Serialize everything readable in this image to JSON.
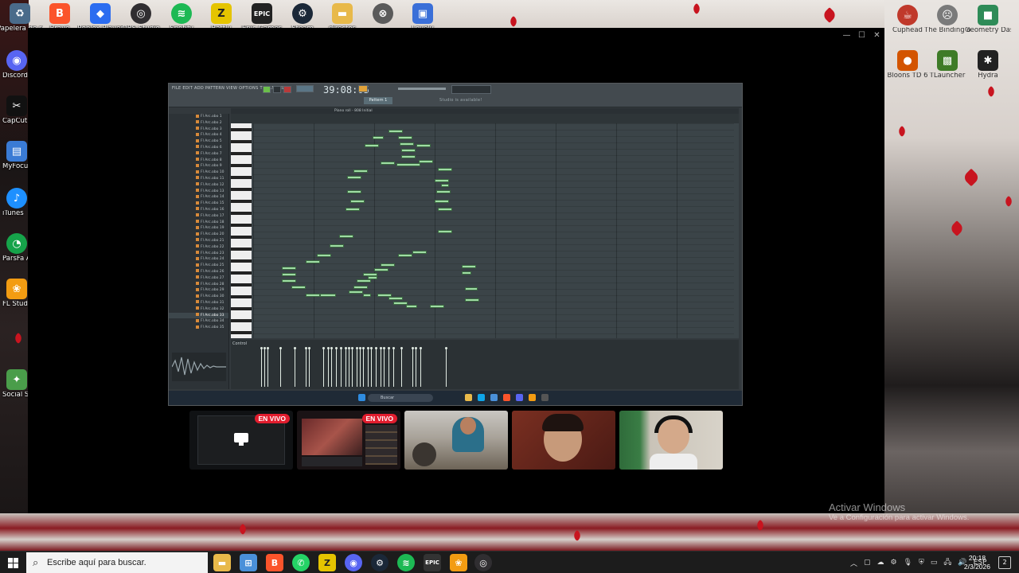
{
  "desktop": {
    "top_icons": [
      {
        "label": "Papelera de reciclaje",
        "icon": "recycle-bin-icon",
        "color": "#4a6b8a"
      },
      {
        "label": "Brave",
        "icon": "brave-icon",
        "color": "#fb542b"
      },
      {
        "label": "Roblox Player",
        "icon": "roblox-icon",
        "color": "#2b6cf0"
      },
      {
        "label": "OBS Studio",
        "icon": "obs-icon",
        "color": "#302e31"
      },
      {
        "label": "Spotify",
        "icon": "spotify-icon",
        "color": "#1db954"
      },
      {
        "label": "Battly",
        "icon": "battly-icon",
        "color": "#e5c400"
      },
      {
        "label": "Epic Games",
        "icon": "epic-games-icon",
        "color": "#222222"
      },
      {
        "label": "Steam",
        "icon": "steam-icon",
        "color": "#1b2838"
      },
      {
        "label": "directos",
        "icon": "folder-icon",
        "color": "#e8b94a"
      },
      {
        "label": "",
        "icon": "app-icon",
        "color": "#5a5a5a"
      },
      {
        "label": "Lovely",
        "icon": "lovely-icon",
        "color": "#3a6fd8"
      }
    ],
    "left_icons": [
      {
        "label": "Discord",
        "icon": "discord-icon",
        "color": "#5865f2"
      },
      {
        "label": "CapCut",
        "icon": "capcut-icon",
        "color": "#111111"
      },
      {
        "label": "MyFocus LockWi...",
        "icon": "lock-icon",
        "color": "#3a7bd5"
      },
      {
        "label": "iTunes",
        "icon": "itunes-icon",
        "color": "#1e90ff"
      },
      {
        "label": "ParsFa Andro...",
        "icon": "android-icon",
        "color": "#16a34a"
      },
      {
        "label": "FL Studio",
        "icon": "fl-studio-icon",
        "color": "#f39c12"
      },
      {
        "label": "Social Stre... Ninja",
        "icon": "ninja-icon",
        "color": "#4a9d4a"
      }
    ],
    "right_icons": [
      {
        "label": "Cuphead",
        "icon": "cuphead-icon",
        "color": "#c0392b"
      },
      {
        "label": "The Binding of Isaac R...",
        "icon": "isaac-icon",
        "color": "#7a7a7a"
      },
      {
        "label": "Geometry Dash",
        "icon": "geometry-dash-icon",
        "color": "#2e8b57"
      },
      {
        "label": "Bloons TD 6",
        "icon": "bloons-icon",
        "color": "#d35400"
      },
      {
        "label": "TLauncher",
        "icon": "minecraft-icon",
        "color": "#3e7b27"
      },
      {
        "label": "Hydra",
        "icon": "hydra-icon",
        "color": "#222222"
      }
    ]
  },
  "window": {
    "controls": {
      "minimize": "—",
      "maximize": "☐",
      "close": "✕"
    }
  },
  "fl": {
    "menu": "FILE EDIT ADD PATTERN VIEW OPTIONS TOOLS HELP",
    "time": "39:08:05",
    "pattern": "Pattern 1",
    "hint": "Studio is available!",
    "plugin_bar": "Piano roll - 808 Initial",
    "control_label": "Control",
    "browser_rows": [
      "Fl Arc.obo 1",
      "Fl Arc.obo 2",
      "Fl Arc.obo 3",
      "Fl Arc.obo 4",
      "Fl Arc.obo 5",
      "Fl Arc.obo 6",
      "Fl Arc.obo 7",
      "Fl Arc.obo 8",
      "Fl Arc.obo 9",
      "Fl Arc.obo 10",
      "Fl Arc.obo 11",
      "Fl Arc.obo 12",
      "Fl Arc.obo 13",
      "Fl Arc.obo 14",
      "Fl Arc.obo 15",
      "Fl Arc.obo 16",
      "Fl Arc.obo 17",
      "Fl Arc.obo 18",
      "Fl Arc.obo 19",
      "Fl Arc.obo 20",
      "Fl Arc.obo 21",
      "Fl Arc.obo 22",
      "Fl Arc.obo 23",
      "Fl Arc.obo 24",
      "Fl Arc.obo 25",
      "Fl Arc.obo 26",
      "Fl Arc.obo 27",
      "Fl Arc.obo 28",
      "Fl Arc.obo 29",
      "Fl Arc.obo 30",
      "Fl Arc.obo 31",
      "Fl Arc.obo 32",
      "Fl Arc.obo 33",
      "Fl Arc.obo 34",
      "Fl Arc.obo 35"
    ],
    "search_placeholder": "Buscar"
  },
  "participants": [
    {
      "badge": "EN VIVO",
      "kind": "screen"
    },
    {
      "badge": "EN VIVO",
      "kind": "stream"
    },
    {
      "badge": "",
      "kind": "camera"
    },
    {
      "badge": "",
      "kind": "camera"
    },
    {
      "badge": "",
      "kind": "camera"
    }
  ],
  "watermark": {
    "title": "Activar Windows",
    "subtitle": "Ve a Configuración para activar Windows."
  },
  "taskbar": {
    "search_placeholder": "Escribe aquí para buscar.",
    "apps": [
      {
        "icon": "file-explorer-icon",
        "color": "#e8b94a"
      },
      {
        "icon": "store-icon",
        "color": "#4a90d9"
      },
      {
        "icon": "brave-icon",
        "color": "#fb542b"
      },
      {
        "icon": "whatsapp-icon",
        "color": "#25d366"
      },
      {
        "icon": "battly-icon",
        "color": "#e5c400"
      },
      {
        "icon": "discord-icon",
        "color": "#5865f2"
      },
      {
        "icon": "steam-icon",
        "color": "#1b2838"
      },
      {
        "icon": "spotify-icon",
        "color": "#1db954"
      },
      {
        "icon": "epic-games-icon",
        "color": "#333333"
      },
      {
        "icon": "fl-studio-icon",
        "color": "#f39c12"
      },
      {
        "icon": "obs-icon",
        "color": "#302e31"
      }
    ],
    "language": "ESP",
    "time": "20:18",
    "date": "2/3/2026",
    "notifications": "2"
  }
}
